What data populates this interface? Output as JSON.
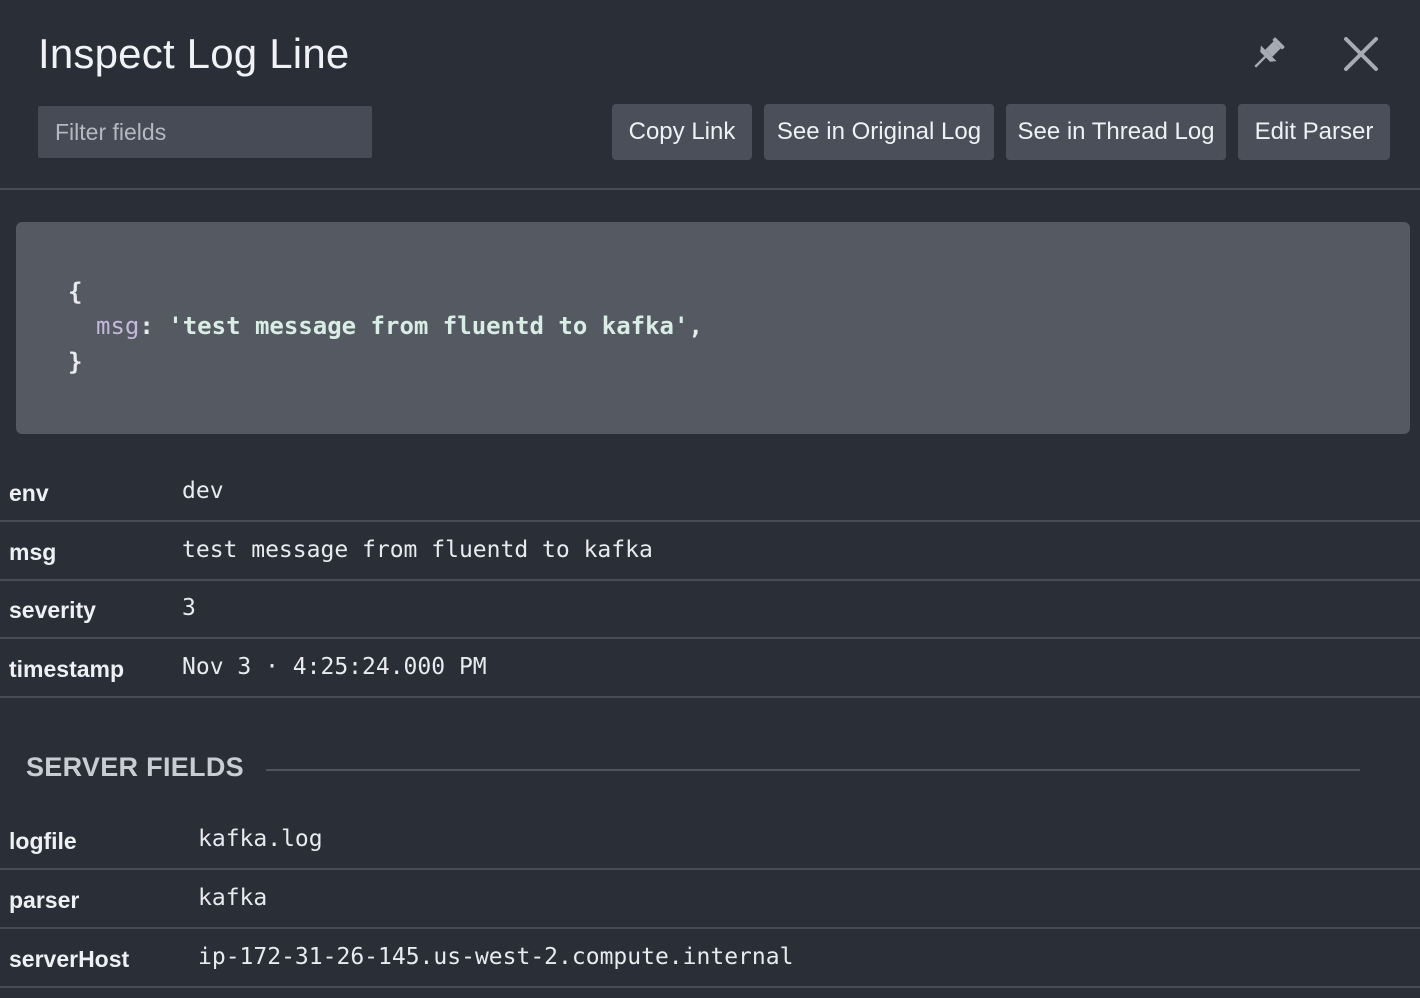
{
  "header": {
    "title": "Inspect Log Line",
    "pin_icon": "pin-icon",
    "close_icon": "close-icon"
  },
  "filter": {
    "placeholder": "Filter fields",
    "value": ""
  },
  "toolbar": {
    "copy_link": "Copy Link",
    "see_original": "See in Original Log",
    "see_thread": "See in Thread Log",
    "edit_parser": "Edit Parser"
  },
  "code_block": {
    "open_brace": "{",
    "key": "msg",
    "colon": ": ",
    "value": "'test message from fluentd to kafka'",
    "trailing": ",",
    "close_brace": "}"
  },
  "fields": [
    {
      "key": "env",
      "value": "dev"
    },
    {
      "key": "msg",
      "value": "test message from fluentd to kafka"
    },
    {
      "key": "severity",
      "value": "3"
    },
    {
      "key": "timestamp",
      "value": "Nov 3 · 4:25:24.000 PM"
    }
  ],
  "server_fields": {
    "title": "SERVER FIELDS",
    "items": [
      {
        "key": "logfile",
        "value": "kafka.log"
      },
      {
        "key": "parser",
        "value": "kafka"
      },
      {
        "key": "serverHost",
        "value": "ip-172-31-26-145.us-west-2.compute.internal"
      }
    ]
  },
  "colors": {
    "background": "#2a2e37",
    "code_background": "#555961",
    "button_background": "#4a4f59",
    "divider": "#464b55",
    "code_key": "#c4b8dc"
  }
}
